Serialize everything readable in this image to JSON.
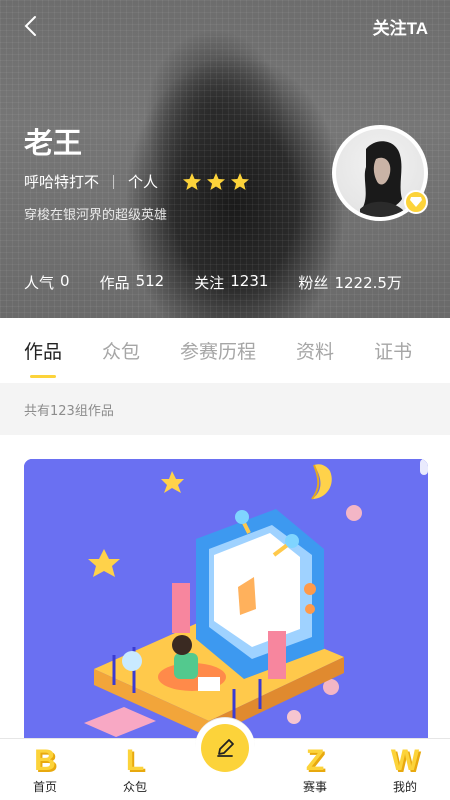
{
  "header": {
    "follow_label": "关注TA"
  },
  "profile": {
    "name": "老王",
    "nickname": "呼哈特打不",
    "type": "个人",
    "stars": 3,
    "bio": "穿梭在银河界的超级英雄"
  },
  "stats": [
    {
      "label": "人气",
      "value": "0"
    },
    {
      "label": "作品",
      "value": "512"
    },
    {
      "label": "关注",
      "value": "1231"
    },
    {
      "label": "粉丝",
      "value": "1222.5万"
    }
  ],
  "tabs": [
    {
      "label": "作品",
      "active": true
    },
    {
      "label": "众包",
      "active": false
    },
    {
      "label": "参赛历程",
      "active": false
    },
    {
      "label": "资料",
      "active": false
    },
    {
      "label": "证书",
      "active": false
    }
  ],
  "works": {
    "count_text": "共有123组作品"
  },
  "bottom_nav": [
    {
      "letter": "B",
      "label": "首页"
    },
    {
      "letter": "L",
      "label": "众包"
    },
    {
      "letter": "",
      "label": ""
    },
    {
      "letter": "Z",
      "label": "赛事"
    },
    {
      "letter": "W",
      "label": "我的"
    }
  ],
  "colors": {
    "accent": "#fcd33a",
    "card_bg": "#6a70f2"
  }
}
